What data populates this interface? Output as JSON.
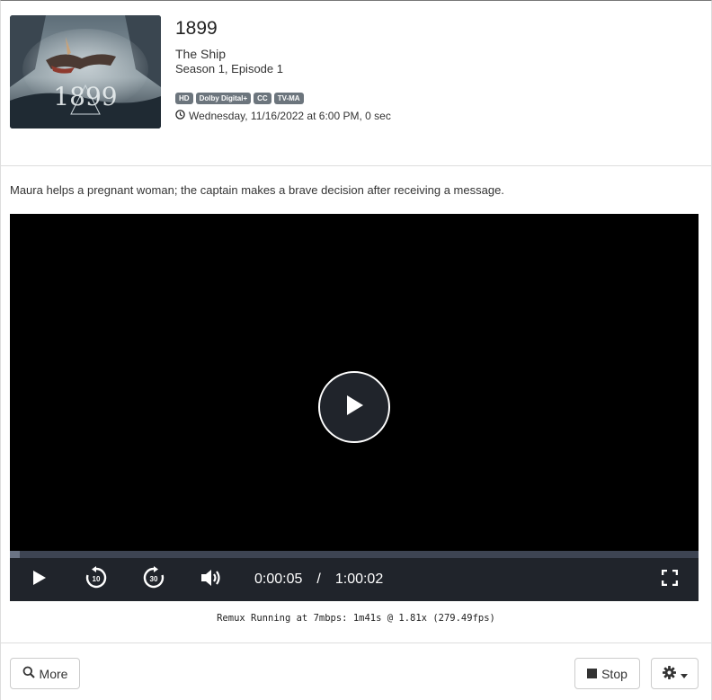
{
  "show": {
    "title": "1899",
    "episode_name": "The Ship",
    "episode_number": "Season 1, Episode 1",
    "poster_text": "1899",
    "badges": [
      "HD",
      "Dolby Digital+",
      "CC",
      "TV-MA"
    ],
    "air_date": "Wednesday, 11/16/2022 at 6:00 PM, 0 sec"
  },
  "summary": "Maura helps a pregnant woman; the captain makes a brave decision after receiving a message.",
  "player": {
    "current_time": "0:00:05",
    "separator": "/",
    "duration": "1:00:02",
    "progress": 0.014,
    "rewind_label": "10",
    "forward_label": "30"
  },
  "status_text": "Remux Running at 7mbps: 1m41s @ 1.81x (279.49fps)",
  "actions": {
    "more_label": "More",
    "stop_label": "Stop"
  },
  "icons": {
    "poster": "poster-image",
    "clock": "clock-icon",
    "play": "play-icon",
    "rewind": "rewind-10-icon",
    "forward": "forward-30-icon",
    "volume": "volume-icon",
    "fullscreen": "fullscreen-icon",
    "search": "search-icon",
    "stop": "stop-icon",
    "gear": "gear-icon",
    "caret": "caret-down-icon"
  }
}
